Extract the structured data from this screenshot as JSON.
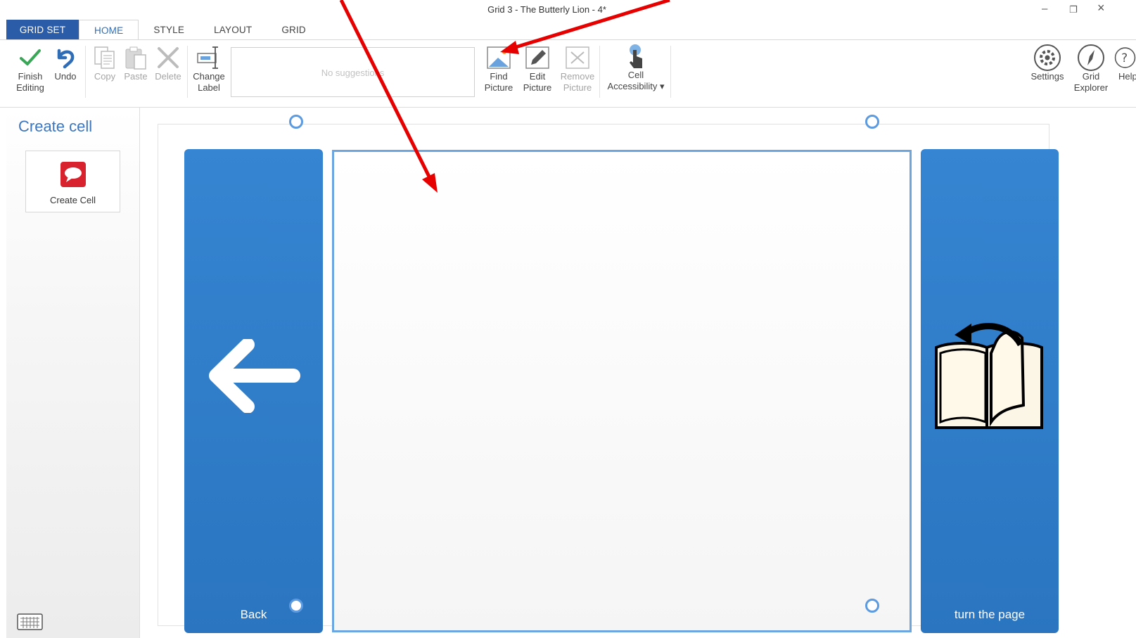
{
  "window": {
    "title": "Grid 3 - The Butterly Lion - 4*",
    "minimize_glyph": "‒",
    "restore_glyph": "❐",
    "close_glyph": "×"
  },
  "tabs": [
    {
      "label": "GRID SET"
    },
    {
      "label": "HOME"
    },
    {
      "label": "STYLE"
    },
    {
      "label": "LAYOUT"
    },
    {
      "label": "GRID"
    }
  ],
  "active_tab": "HOME",
  "ribbon": {
    "finish_line1": "Finish",
    "finish_line2": "Editing",
    "undo": "Undo",
    "copy": "Copy",
    "paste": "Paste",
    "delete": "Delete",
    "change_line1": "Change",
    "change_line2": "Label",
    "suggestions_placeholder": "No suggestions",
    "find_line1": "Find",
    "find_line2": "Picture",
    "edit_line1": "Edit",
    "edit_line2": "Picture",
    "remove_line1": "Remove",
    "remove_line2": "Picture",
    "cell_line1": "Cell",
    "cell_line2": "Accessibility ▾",
    "settings": "Settings",
    "grid_line1": "Grid",
    "grid_line2": "Explorer",
    "help": "Help"
  },
  "left_panel": {
    "title": "Create cell",
    "create_cell_label": "Create Cell"
  },
  "grid": {
    "back_label": "Back",
    "turn_label": "turn the page"
  },
  "colors": {
    "accent": "#2f6db7",
    "gridset_tab": "#2a5ca8",
    "cell_blue": "#2f7dcb",
    "selection": "#6ca6e0",
    "annotation_arrow": "#e60000"
  },
  "icons": [
    "check-icon",
    "undo-icon",
    "copy-icon",
    "paste-icon",
    "delete-icon",
    "change-label-icon",
    "find-picture-icon",
    "edit-picture-icon",
    "remove-picture-icon",
    "touch-icon",
    "settings-icon",
    "compass-icon",
    "help-icon",
    "speech-bubble-icon",
    "keyboard-icon",
    "arrow-left-icon",
    "book-turn-page-icon"
  ]
}
